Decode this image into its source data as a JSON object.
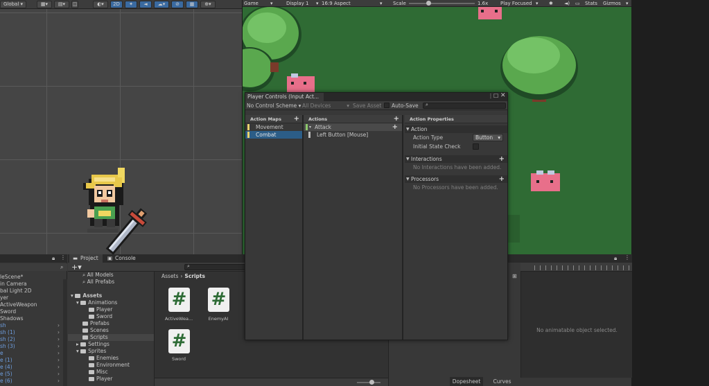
{
  "scene": {
    "toolbar": {
      "global_label": "Global",
      "mode_2d": "2D"
    }
  },
  "game": {
    "toolbar": {
      "tab": "Game",
      "display": "Display 1",
      "aspect": "16:9 Aspect",
      "scale_label": "Scale",
      "scale_value": "1.6x",
      "play_mode": "Play Focused",
      "stats": "Stats",
      "gizmos": "Gizmos"
    }
  },
  "input_actions": {
    "title": "Player Controls (Input Act...",
    "toolbar": {
      "control_scheme": "No Control Scheme",
      "devices": "All Devices",
      "save_asset": "Save Asset",
      "auto_save": "Auto-Save"
    },
    "action_maps": {
      "header": "Action Maps",
      "items": [
        {
          "label": "Movement",
          "selected": false
        },
        {
          "label": "Combat",
          "selected": true
        }
      ]
    },
    "actions": {
      "header": "Actions",
      "action": "Attack",
      "binding": "Left Button [Mouse]"
    },
    "properties": {
      "header": "Action Properties",
      "action_section": "Action",
      "action_type_label": "Action Type",
      "action_type_value": "Button",
      "initial_state_label": "Initial State Check",
      "interactions_section": "Interactions",
      "interactions_empty": "No Interactions have been added.",
      "processors_section": "Processors",
      "processors_empty": "No Processors have been added."
    }
  },
  "hierarchy": {
    "items": [
      {
        "label": "leScene*",
        "blue": false,
        "arrow": false
      },
      {
        "label": "in Camera",
        "blue": false,
        "arrow": false
      },
      {
        "label": "bal Light 2D",
        "blue": false,
        "arrow": false
      },
      {
        "label": "yer",
        "blue": false,
        "arrow": false
      },
      {
        "label": "ActiveWeapon",
        "blue": false,
        "arrow": false
      },
      {
        "label": "Sword",
        "blue": false,
        "arrow": false
      },
      {
        "label": "Shadows",
        "blue": false,
        "arrow": false
      },
      {
        "label": "sh",
        "blue": true,
        "arrow": true
      },
      {
        "label": "sh (1)",
        "blue": true,
        "arrow": true
      },
      {
        "label": "sh (2)",
        "blue": true,
        "arrow": true
      },
      {
        "label": "sh (3)",
        "blue": true,
        "arrow": true
      },
      {
        "label": "e",
        "blue": true,
        "arrow": true
      },
      {
        "label": "e (1)",
        "blue": true,
        "arrow": true
      },
      {
        "label": "e (4)",
        "blue": true,
        "arrow": true
      },
      {
        "label": "e (5)",
        "blue": true,
        "arrow": true
      },
      {
        "label": "e (6)",
        "blue": true,
        "arrow": true
      }
    ]
  },
  "project": {
    "tabs": {
      "project": "Project",
      "console": "Console"
    },
    "tree": {
      "all_models": "All Models",
      "all_prefabs": "All Prefabs",
      "assets": "Assets",
      "animations": "Animations",
      "player": "Player",
      "sword": "Sword",
      "prefabs": "Prefabs",
      "scenes": "Scenes",
      "scripts": "Scripts",
      "settings": "Settings",
      "sprites": "Sprites",
      "enemies": "Enemies",
      "environment": "Environment",
      "misc": "Misc",
      "player2": "Player"
    },
    "breadcrumb": {
      "root": "Assets",
      "current": "Scripts"
    },
    "files": [
      {
        "name": "ActiveWea..."
      },
      {
        "name": "EnemyAI"
      },
      {
        "name": "Sword"
      }
    ],
    "script_glyph": "#"
  },
  "animation": {
    "empty": "No animatable object selected.",
    "dopesheet": "Dopesheet",
    "curves": "Curves"
  },
  "colors": {
    "accent": "#2c5d87",
    "grass": "#2f6b34",
    "map_stripe": "#e8d36b",
    "action_stripe": "#8cc86b"
  }
}
